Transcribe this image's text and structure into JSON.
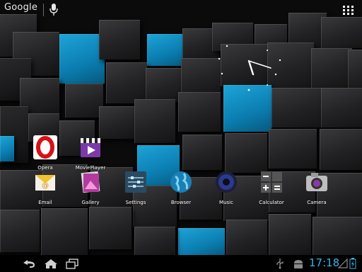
{
  "search": {
    "label": "Google"
  },
  "apps": [
    {
      "name": "opera",
      "label": "Opera"
    },
    {
      "name": "movieplayer",
      "label": "MoviePlayer"
    },
    {
      "name": "email",
      "label": "Email"
    },
    {
      "name": "gallery",
      "label": "Gallery"
    },
    {
      "name": "settings",
      "label": "Settings"
    },
    {
      "name": "browser",
      "label": "Browser"
    },
    {
      "name": "music",
      "label": "Music"
    },
    {
      "name": "calculator",
      "label": "Calculator"
    },
    {
      "name": "camera",
      "label": "Camera"
    }
  ],
  "status": {
    "time": "17:18"
  },
  "colors": {
    "accent": "#33b5e5",
    "cube_blue": "#0b8dc4"
  },
  "icons": [
    "microphone-icon",
    "all-apps-icon",
    "back-icon",
    "home-icon",
    "recent-apps-icon",
    "usb-icon",
    "android-icon",
    "wifi-icon",
    "battery-icon"
  ]
}
